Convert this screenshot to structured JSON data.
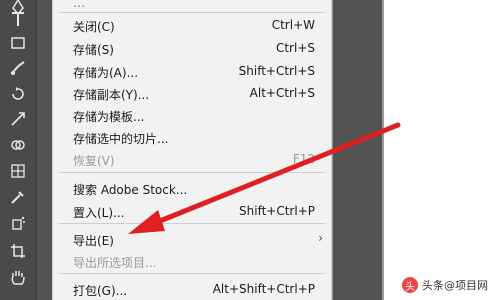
{
  "menu": {
    "items": [
      {
        "label": "关闭(C)",
        "shortcut": "Ctrl+W"
      },
      {
        "label": "存储(S)",
        "shortcut": "Ctrl+S"
      },
      {
        "label": "存储为(A)...",
        "shortcut": "Shift+Ctrl+S"
      },
      {
        "label": "存储副本(Y)...",
        "shortcut": "Alt+Ctrl+S"
      },
      {
        "label": "存储为模板...",
        "shortcut": ""
      },
      {
        "label": "存储选中的切片...",
        "shortcut": ""
      },
      {
        "label": "恢复(V)",
        "shortcut": "F12"
      },
      {
        "label": "搜索 Adobe Stock...",
        "shortcut": ""
      },
      {
        "label": "置入(L)...",
        "shortcut": "Shift+Ctrl+P"
      },
      {
        "label": "导出(E)",
        "shortcut": "›"
      },
      {
        "label": "导出所选项目...",
        "shortcut": ""
      },
      {
        "label": "打包(G)...",
        "shortcut": "Alt+Shift+Ctrl+P"
      }
    ]
  },
  "tools": [
    {
      "name": "pen-tool-icon"
    },
    {
      "name": "type-tool-icon"
    },
    {
      "name": "rectangle-tool-icon"
    },
    {
      "name": "brush-tool-icon"
    },
    {
      "name": "rotate-tool-icon"
    },
    {
      "name": "scale-tool-icon"
    },
    {
      "name": "shape-builder-icon"
    },
    {
      "name": "mesh-tool-icon"
    },
    {
      "name": "eyedropper-tool-icon"
    },
    {
      "name": "symbol-sprayer-icon"
    },
    {
      "name": "artboard-tool-icon"
    },
    {
      "name": "hand-tool-icon"
    }
  ],
  "annotation": {
    "arrow_color": "#e02020"
  },
  "watermark": {
    "text": "头条@项目网"
  }
}
